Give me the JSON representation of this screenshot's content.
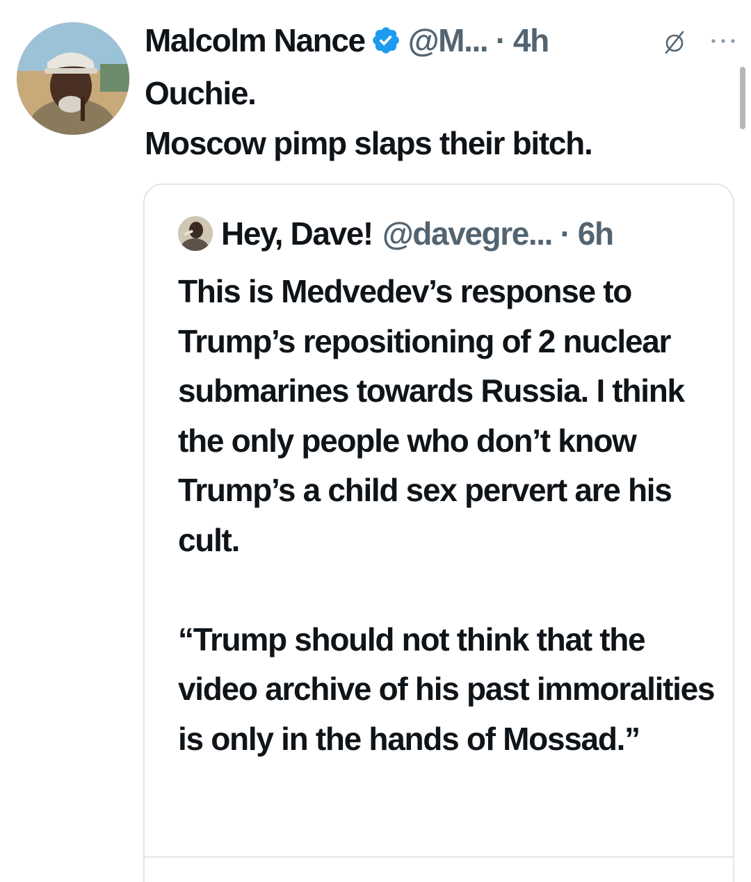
{
  "tweet": {
    "author_name": "Malcolm Nance",
    "author_handle": "@M...",
    "time": "4h",
    "separator": "·",
    "avatar_icon": "user-avatar-photo",
    "verified_icon": "verified-badge-icon",
    "verified_color": "#1d9bf0",
    "text": "Ouchie.\nMoscow pimp slaps their bitch.",
    "menu_icon": "more-options-icon",
    "grok_icon": "grok-icon"
  },
  "quoted_tweet": {
    "author_name": "Hey, Dave!",
    "author_handle": "@davegre...",
    "time": "6h",
    "separator": "·",
    "avatar_icon": "user-avatar-photo",
    "text": "This is Medvedev’s response to Trump’s repositioning of 2 nuclear submarines towards Russia. I think the only people who don’t know Trump’s a child sex pervert are his cult.\n\n“Trump should not think that the video archive of his past immoralities is only in the hands of Mossad.”"
  },
  "colors": {
    "text_primary": "#0f1419",
    "text_secondary": "#536471",
    "border": "#e1e5e8",
    "background": "#ffffff"
  }
}
